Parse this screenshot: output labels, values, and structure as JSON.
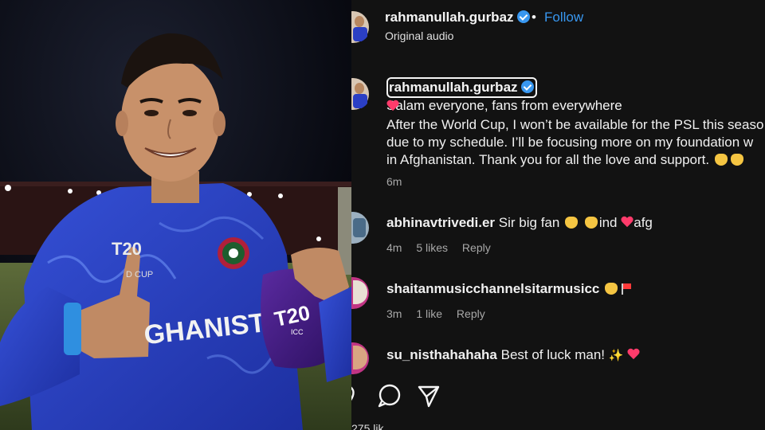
{
  "post": {
    "username": "rahmanullah.gurbaz",
    "dot": "•",
    "follow_label": "Follow",
    "audio": "Original audio"
  },
  "photo": {
    "jersey_text": "GHANISTAN",
    "cup_text": "D CUP",
    "cap_logo": "T20",
    "cap_sub": "ICC",
    "colors": {
      "jersey": "#2b3fc4",
      "cap": "#4a1f8a",
      "stadium": "#0c0e1a"
    }
  },
  "caption": {
    "username": "rahmanullah.gurbaz",
    "line1": "Salam everyone, fans from everywhere",
    "line2": "After the World Cup, I won’t be available for the PSL this seaso",
    "line3": "due to my schedule. I’ll be focusing more on my foundation w",
    "line4": "in Afghanistan. Thank you for all the love and support.",
    "time": "6m"
  },
  "comments": [
    {
      "username": "abhinavtrivedi.er",
      "text_a": "Sir big fan",
      "text_b": "ind",
      "text_c": "afg",
      "time": "4m",
      "likes": "5 likes",
      "reply": "Reply"
    },
    {
      "username": "shaitanmusicchannelsitarmusicc",
      "time": "3m",
      "likes": "1 like",
      "reply": "Reply"
    },
    {
      "username": "su_nisthahahaha",
      "text": "Best of luck man!"
    }
  ],
  "actions": {
    "icons": [
      "heart-icon",
      "comment-icon",
      "share-icon"
    ]
  },
  "likes_partial": "275 lik",
  "colors": {
    "background": "#121212",
    "link": "#3897f0",
    "verified": "#3897f0",
    "muted": "#a8a8a8"
  }
}
